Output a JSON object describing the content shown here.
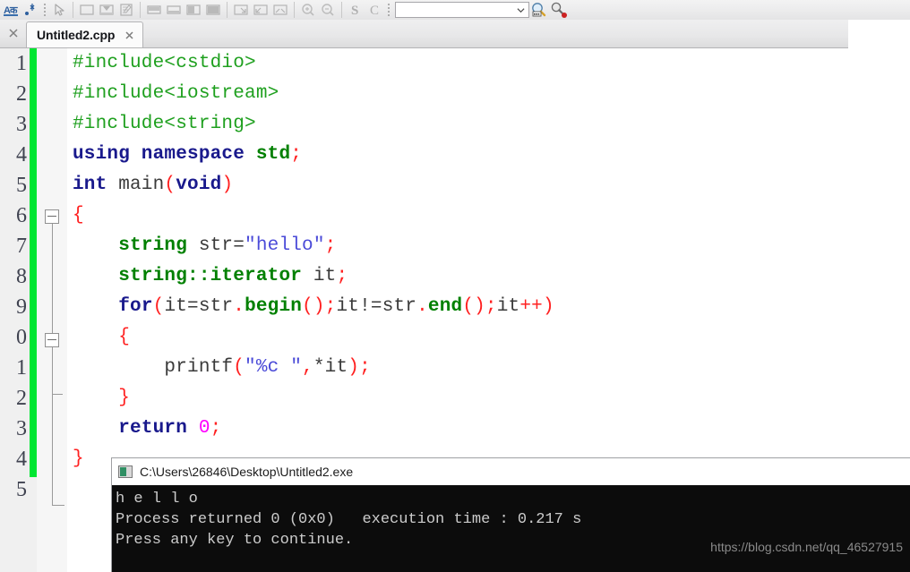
{
  "toolbar": {
    "icons": [
      {
        "name": "abbreviation-icon",
        "label": "Abbreviation"
      },
      {
        "name": "syntax-highlight-icon",
        "label": "Syntax highlighting"
      },
      {
        "name": "pointer-icon",
        "label": "Select"
      },
      {
        "name": "new-shape-icon",
        "label": "New shape"
      },
      {
        "name": "insert-image-icon",
        "label": "Insert image"
      },
      {
        "name": "properties-icon",
        "label": "Properties"
      },
      {
        "name": "align-top-icon",
        "label": "Align top"
      },
      {
        "name": "align-bottom-icon",
        "label": "Align bottom"
      },
      {
        "name": "align-left-icon",
        "label": "Align left"
      },
      {
        "name": "align-right-icon",
        "label": "Align right"
      },
      {
        "name": "resize-se-icon",
        "label": "Resize"
      },
      {
        "name": "resize-sw-icon",
        "label": "Resize alt"
      },
      {
        "name": "resize-both-icon",
        "label": "Resize both"
      },
      {
        "name": "zoom-in-icon",
        "label": "Zoom in"
      },
      {
        "name": "zoom-out-icon",
        "label": "Zoom out"
      },
      {
        "name": "letter-s-icon",
        "label": "S"
      },
      {
        "name": "letter-c-icon",
        "label": "C"
      }
    ],
    "search_combo": {
      "value": "",
      "placeholder": ""
    },
    "find_icon": "find-icon",
    "find_replace_icon": "find-replace-icon"
  },
  "tabbar": {
    "close_all_label": "×",
    "tabs": [
      {
        "label": "Untitled2.cpp",
        "close_label": "×",
        "active": true
      }
    ]
  },
  "editor": {
    "line_numbers": [
      "1",
      "2",
      "3",
      "4",
      "5",
      "6",
      "7",
      "8",
      "9",
      "0",
      "1",
      "2",
      "3",
      "4",
      "5"
    ],
    "lines": [
      "#include<cstdio>",
      "#include<iostream>",
      "#include<string>",
      "using namespace std;",
      "int main(void)",
      "{",
      "    string str=\"hello\";",
      "    string::iterator it;",
      "    for(it=str.begin();it!=str.end();it++)",
      "    {",
      "        printf(\"%c \",*it);",
      "    }",
      "    return 0;",
      "}",
      ""
    ],
    "change_marker_color": "#00e632"
  },
  "console": {
    "title": "C:\\Users\\26846\\Desktop\\Untitled2.exe",
    "icon": "console-app-icon",
    "output": [
      "h e l l o",
      "Process returned 0 (0x0)   execution time : 0.217 s",
      "Press any key to continue."
    ]
  },
  "watermark": {
    "text": "https://blog.csdn.net/qq_46527915"
  }
}
